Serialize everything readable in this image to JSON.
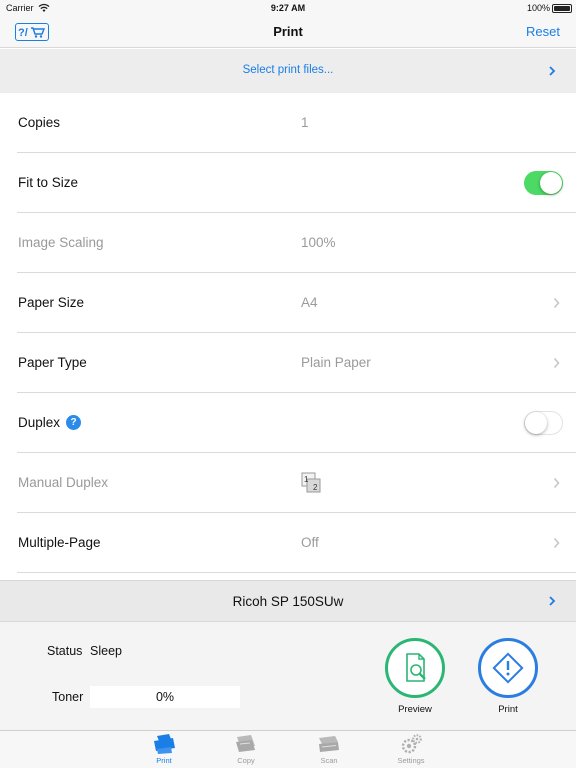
{
  "status_bar": {
    "carrier": "Carrier",
    "time": "9:27 AM",
    "battery": "100%"
  },
  "nav": {
    "title": "Print",
    "reset_label": "Reset",
    "help_cart_icon": "help-cart-icon"
  },
  "select_files": {
    "label": "Select print files..."
  },
  "settings": {
    "copies": {
      "label": "Copies",
      "value": "1"
    },
    "fit_to_size": {
      "label": "Fit to Size",
      "enabled": true
    },
    "image_scaling": {
      "label": "Image Scaling",
      "value": "100%"
    },
    "paper_size": {
      "label": "Paper Size",
      "value": "A4"
    },
    "paper_type": {
      "label": "Paper Type",
      "value": "Plain Paper"
    },
    "duplex": {
      "label": "Duplex",
      "help": "?",
      "enabled": false
    },
    "manual_duplex": {
      "label": "Manual Duplex",
      "icon": "manual-duplex-1-2-icon",
      "icon_digits": [
        "1",
        "2"
      ]
    },
    "multiple_page": {
      "label": "Multiple-Page",
      "value": "Off"
    }
  },
  "printer": {
    "name": "Ricoh SP 150SUw"
  },
  "device_status": {
    "status_label": "Status",
    "status_value": "Sleep",
    "toner_label": "Toner",
    "toner_value": "0%",
    "toner_fraction": 0
  },
  "actions": {
    "preview_label": "Preview",
    "print_label": "Print"
  },
  "tabs": [
    {
      "label": "Print",
      "icon": "printer-icon",
      "active": true
    },
    {
      "label": "Copy",
      "icon": "copy-icon",
      "active": false
    },
    {
      "label": "Scan",
      "icon": "scanner-icon",
      "active": false
    },
    {
      "label": "Settings",
      "icon": "gears-icon",
      "active": false
    }
  ],
  "colors": {
    "accent": "#1a7ee6",
    "toggle_on": "#4cd964",
    "preview_ring": "#2bb673",
    "print_ring": "#2a7de1"
  }
}
